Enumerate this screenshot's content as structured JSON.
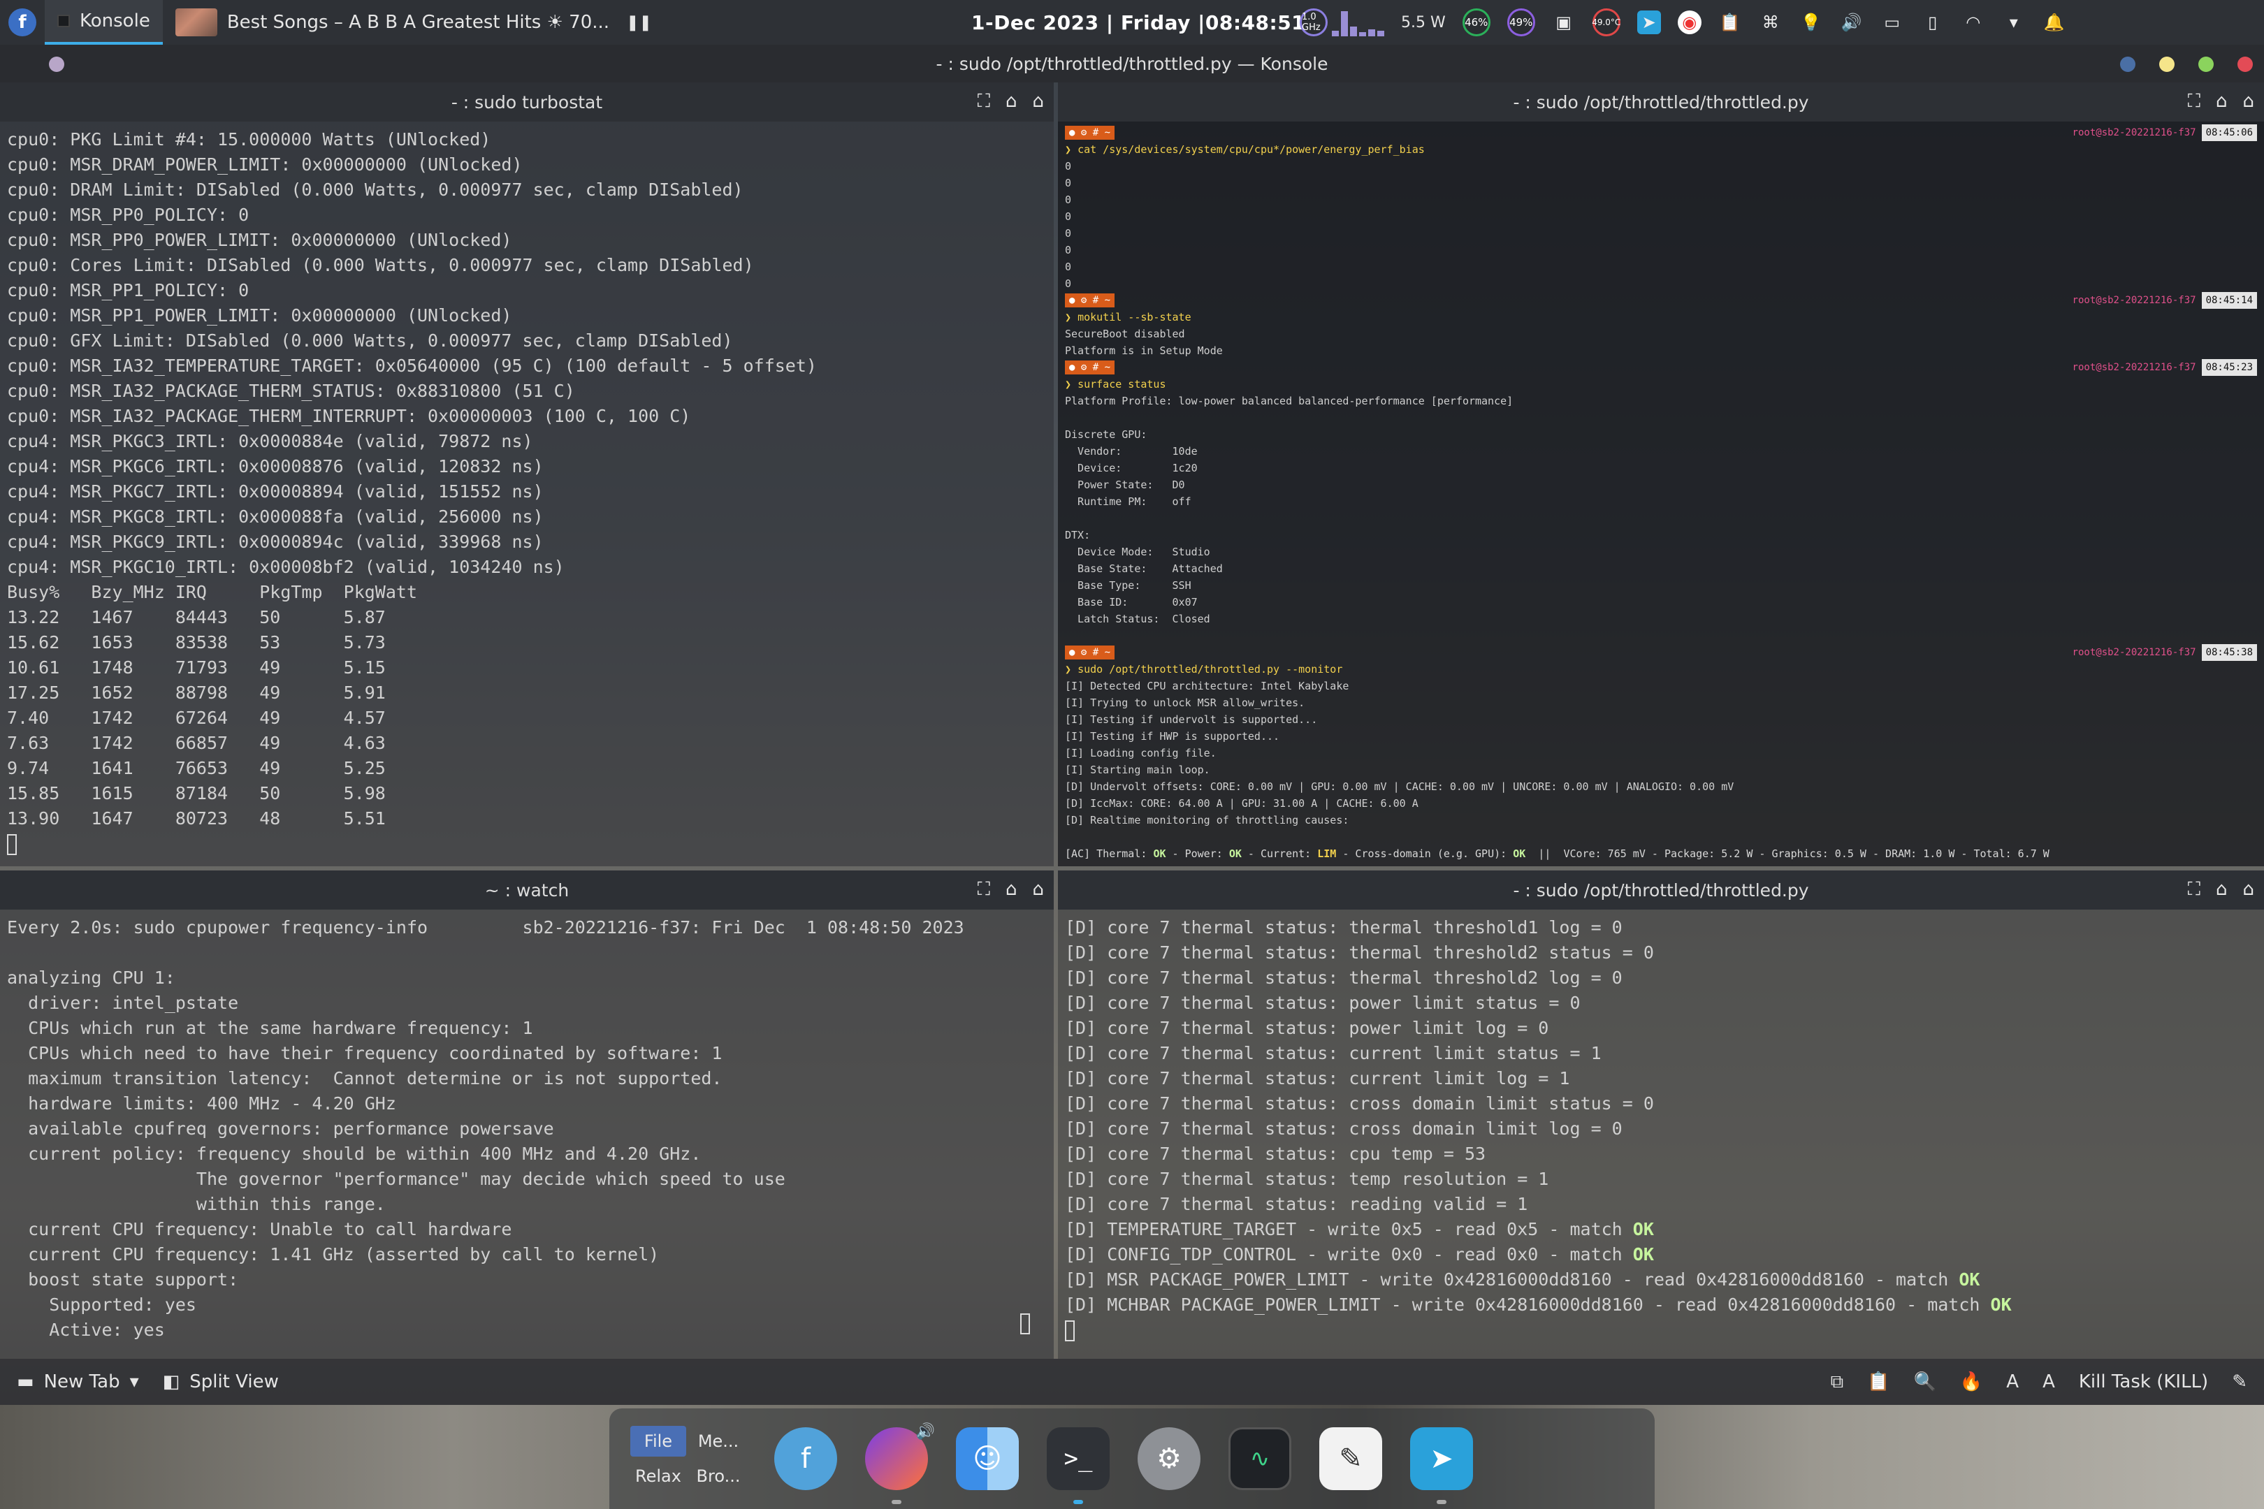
{
  "topbar": {
    "launcher_glyph": "f",
    "app_name": "Konsole",
    "media_title": "Best Songs – A B B A Greatest Hits ☀ 70...",
    "pause_glyph": "❚❚",
    "datetime": "1-Dec 2023 | Friday |08:48:51",
    "tray": {
      "cpu_freq": "1.0 GHz",
      "power": "5.5 W",
      "ram_percent": "46%",
      "swap_percent": "49%",
      "temp": "49.0°C"
    }
  },
  "window": {
    "title": "- : sudo /opt/throttled/throttled.py — Konsole"
  },
  "panes": {
    "top_left": {
      "title": "- : sudo turbostat",
      "lines": [
        "cpu0: PKG Limit #4: 15.000000 Watts (UNlocked)",
        "cpu0: MSR_DRAM_POWER_LIMIT: 0x00000000 (UNlocked)",
        "cpu0: DRAM Limit: DISabled (0.000 Watts, 0.000977 sec, clamp DISabled)",
        "cpu0: MSR_PP0_POLICY: 0",
        "cpu0: MSR_PP0_POWER_LIMIT: 0x00000000 (UNlocked)",
        "cpu0: Cores Limit: DISabled (0.000 Watts, 0.000977 sec, clamp DISabled)",
        "cpu0: MSR_PP1_POLICY: 0",
        "cpu0: MSR_PP1_POWER_LIMIT: 0x00000000 (UNlocked)",
        "cpu0: GFX Limit: DISabled (0.000 Watts, 0.000977 sec, clamp DISabled)",
        "cpu0: MSR_IA32_TEMPERATURE_TARGET: 0x05640000 (95 C) (100 default - 5 offset)",
        "cpu0: MSR_IA32_PACKAGE_THERM_STATUS: 0x88310800 (51 C)",
        "cpu0: MSR_IA32_PACKAGE_THERM_INTERRUPT: 0x00000003 (100 C, 100 C)",
        "cpu4: MSR_PKGC3_IRTL: 0x0000884e (valid, 79872 ns)",
        "cpu4: MSR_PKGC6_IRTL: 0x00008876 (valid, 120832 ns)",
        "cpu4: MSR_PKGC7_IRTL: 0x00008894 (valid, 151552 ns)",
        "cpu4: MSR_PKGC8_IRTL: 0x000088fa (valid, 256000 ns)",
        "cpu4: MSR_PKGC9_IRTL: 0x0000894c (valid, 339968 ns)",
        "cpu4: MSR_PKGC10_IRTL: 0x00008bf2 (valid, 1034240 ns)",
        "Busy%   Bzy_MHz IRQ     PkgTmp  PkgWatt",
        "13.22   1467    84443   50      5.87",
        "15.62   1653    83538   53      5.73",
        "10.61   1748    71793   49      5.15",
        "17.25   1652    88798   49      5.91",
        "7.40    1742    67264   49      4.57",
        "7.63    1742    66857   49      4.63",
        "9.74    1641    76653   49      5.25",
        "15.85   1615    87184   50      5.98",
        "13.90   1647    80723   48      5.51"
      ]
    },
    "top_right": {
      "title": "- : sudo /opt/throttled/throttled.py",
      "blocks": [
        {
          "host": "root@sb2-20221216-f37",
          "time": "08:45:06",
          "cmd": "cat /sys/devices/system/cpu/cpu*/power/energy_perf_bias",
          "output": [
            "0",
            "0",
            "0",
            "0",
            "0",
            "0",
            "0",
            "0"
          ]
        },
        {
          "host": "root@sb2-20221216-f37",
          "time": "08:45:14",
          "cmd": "mokutil --sb-state",
          "output": [
            "SecureBoot disabled",
            "Platform is in Setup Mode"
          ]
        },
        {
          "host": "root@sb2-20221216-f37",
          "time": "08:45:23",
          "cmd": "surface status",
          "output": [
            "Platform Profile: low-power balanced balanced-performance [performance]",
            "",
            "Discrete GPU:",
            "  Vendor:        10de",
            "  Device:        1c20",
            "  Power State:   D0",
            "  Runtime PM:    off",
            "",
            "DTX:",
            "  Device Mode:   Studio",
            "  Base State:    Attached",
            "  Base Type:     SSH",
            "  Base ID:       0x07",
            "  Latch Status:  Closed",
            ""
          ]
        },
        {
          "host": "root@sb2-20221216-f37",
          "time": "08:45:38",
          "cmd": "sudo /opt/throttled/throttled.py --monitor",
          "output": [
            "[I] Detected CPU architecture: Intel Kabylake",
            "[I] Trying to unlock MSR allow_writes.",
            "[I] Testing if undervolt is supported...",
            "[I] Testing if HWP is supported...",
            "[I] Loading config file.",
            "[I] Starting main loop.",
            "[D] Undervolt offsets: CORE: 0.00 mV | GPU: 0.00 mV | CACHE: 0.00 mV | UNCORE: 0.00 mV | ANALOGIO: 0.00 mV",
            "[D] IccMax: CORE: 64.00 A | GPU: 31.00 A | CACHE: 6.00 A",
            "[D] Realtime monitoring of throttling causes:",
            ""
          ]
        }
      ],
      "status_line": {
        "prefix": "[AC] Thermal: ",
        "thermal": "OK",
        "power_label": " - Power: ",
        "power": "OK",
        "current_label": " - Current: ",
        "current": "LIM",
        "cross_label": " - Cross-domain (e.g. GPU): ",
        "cross": "OK",
        "tail": "  ||  VCore: 765 mV - Package: 5.2 W - Graphics: 0.5 W - DRAM: 1.0 W - Total: 6.7 W"
      }
    },
    "bottom_left": {
      "title": "~ : watch",
      "lines": [
        "Every 2.0s: sudo cpupower frequency-info         sb2-20221216-f37: Fri Dec  1 08:48:50 2023",
        "",
        "analyzing CPU 1:",
        "  driver: intel_pstate",
        "  CPUs which run at the same hardware frequency: 1",
        "  CPUs which need to have their frequency coordinated by software: 1",
        "  maximum transition latency:  Cannot determine or is not supported.",
        "  hardware limits: 400 MHz - 4.20 GHz",
        "  available cpufreq governors: performance powersave",
        "  current policy: frequency should be within 400 MHz and 4.20 GHz.",
        "                  The governor \"performance\" may decide which speed to use",
        "                  within this range.",
        "  current CPU frequency: Unable to call hardware",
        "  current CPU frequency: 1.41 GHz (asserted by call to kernel)",
        "  boost state support:",
        "    Supported: yes",
        "    Active: yes"
      ]
    },
    "bottom_right": {
      "title": "- : sudo /opt/throttled/throttled.py",
      "lines": [
        "[D] core 7 thermal status: thermal threshold1 log = 0",
        "[D] core 7 thermal status: thermal threshold2 status = 0",
        "[D] core 7 thermal status: thermal threshold2 log = 0",
        "[D] core 7 thermal status: power limit status = 0",
        "[D] core 7 thermal status: power limit log = 0",
        "[D] core 7 thermal status: current limit status = 1",
        "[D] core 7 thermal status: current limit log = 1",
        "[D] core 7 thermal status: cross domain limit status = 0",
        "[D] core 7 thermal status: cross domain limit log = 0",
        "[D] core 7 thermal status: cpu temp = 53",
        "[D] core 7 thermal status: temp resolution = 1",
        "[D] core 7 thermal status: reading valid = 1"
      ],
      "match_lines": [
        {
          "text": "[D] TEMPERATURE_TARGET - write 0x5 - read 0x5 - match ",
          "ok": "OK"
        },
        {
          "text": "[D] CONFIG_TDP_CONTROL - write 0x0 - read 0x0 - match ",
          "ok": "OK"
        },
        {
          "text": "[D] MSR PACKAGE_POWER_LIMIT - write 0x42816000dd8160 - read 0x42816000dd8160 - match ",
          "ok": "OK"
        },
        {
          "text": "[D] MCHBAR PACKAGE_POWER_LIMIT - write 0x42816000dd8160 - read 0x42816000dd8160 - match ",
          "ok": "OK"
        }
      ]
    }
  },
  "konsole_bar": {
    "new_tab": "New Tab",
    "split_view": "Split View",
    "kill_task": "Kill Task (KILL)"
  },
  "dock": {
    "tasklist": [
      "File",
      "Me...",
      "Relax",
      "Bro..."
    ],
    "apps": [
      "fedora-icon",
      "firefox-icon",
      "finder-icon",
      "terminal-icon",
      "settings-icon",
      "system-monitor-icon",
      "text-editor-icon",
      "telegram-icon"
    ]
  },
  "colors": {
    "accent": "#3daee9",
    "ok_green": "#c7f59e",
    "prompt_orange": "#d95c1a",
    "host_pink": "#e0508a"
  }
}
